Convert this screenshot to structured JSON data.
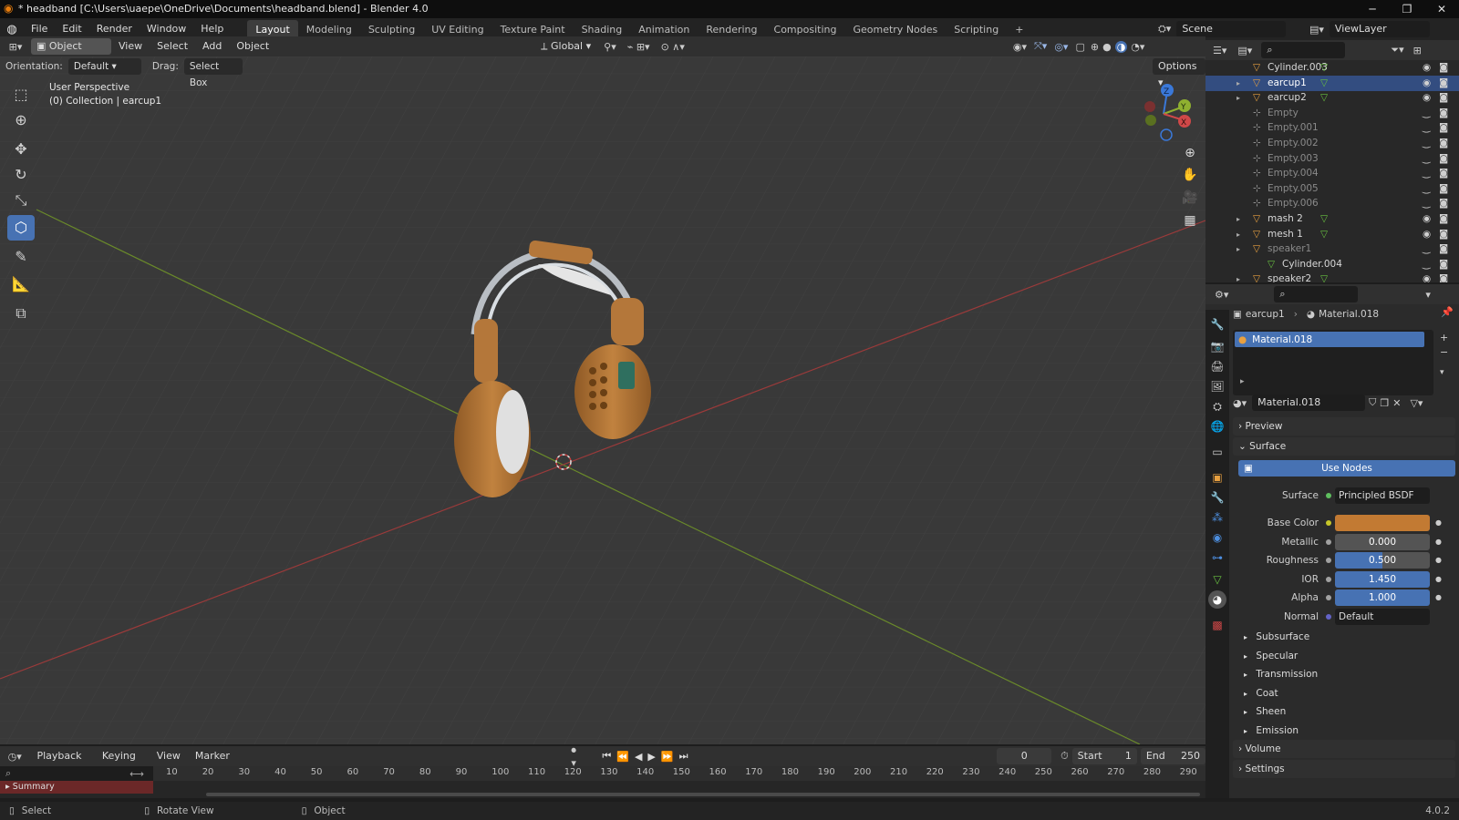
{
  "window": {
    "title": "* headband [C:\\Users\\uaepe\\OneDrive\\Documents\\headband.blend] - Blender 4.0",
    "controls": [
      "─",
      "❐",
      "✕"
    ]
  },
  "menubar": {
    "menus": [
      "File",
      "Edit",
      "Render",
      "Window",
      "Help"
    ],
    "workspaces": [
      "Layout",
      "Modeling",
      "Sculpting",
      "UV Editing",
      "Texture Paint",
      "Shading",
      "Animation",
      "Rendering",
      "Compositing",
      "Geometry Nodes",
      "Scripting"
    ],
    "active_workspace": "Layout",
    "add_tab": "+",
    "scene": "Scene",
    "view_layer": "ViewLayer"
  },
  "viewport_header": {
    "mode": "Object Mode",
    "menus": [
      "View",
      "Select",
      "Add",
      "Object"
    ],
    "transform_orientation": "Global",
    "orientation_label": "Orientation:",
    "orientation_value": "Default",
    "drag_label": "Drag:",
    "drag_value": "Select Box",
    "options": "Options"
  },
  "viewport": {
    "perspective": "User Perspective",
    "collection": "(0) Collection | earcup1",
    "gizmo_axes": [
      "X",
      "Y",
      "Z"
    ],
    "tools": [
      "select-box-tool",
      "cursor-tool",
      "move-tool",
      "rotate-tool",
      "scale-tool",
      "transform-tool",
      "annotate-tool",
      "measure-tool",
      "add-cube-tool"
    ],
    "active_tool": "transform-tool"
  },
  "outliner": {
    "items": [
      {
        "name": "Cylinder.003",
        "type": "mesh",
        "expand": false,
        "selected": false,
        "visible": true,
        "dim": false
      },
      {
        "name": "earcup1",
        "type": "mesh",
        "expand": true,
        "selected": true,
        "visible": true,
        "dim": false
      },
      {
        "name": "earcup2",
        "type": "mesh",
        "expand": true,
        "selected": false,
        "visible": true,
        "dim": false
      },
      {
        "name": "Empty",
        "type": "empty",
        "expand": false,
        "selected": false,
        "visible": false,
        "dim": true
      },
      {
        "name": "Empty.001",
        "type": "empty",
        "expand": false,
        "selected": false,
        "visible": false,
        "dim": true
      },
      {
        "name": "Empty.002",
        "type": "empty",
        "expand": false,
        "selected": false,
        "visible": false,
        "dim": true
      },
      {
        "name": "Empty.003",
        "type": "empty",
        "expand": false,
        "selected": false,
        "visible": false,
        "dim": true
      },
      {
        "name": "Empty.004",
        "type": "empty",
        "expand": false,
        "selected": false,
        "visible": false,
        "dim": true
      },
      {
        "name": "Empty.005",
        "type": "empty",
        "expand": false,
        "selected": false,
        "visible": false,
        "dim": true
      },
      {
        "name": "Empty.006",
        "type": "empty",
        "expand": false,
        "selected": false,
        "visible": false,
        "dim": true
      },
      {
        "name": "mash 2",
        "type": "mesh",
        "expand": true,
        "selected": false,
        "visible": true,
        "dim": false
      },
      {
        "name": "mesh 1",
        "type": "mesh",
        "expand": true,
        "selected": false,
        "visible": true,
        "dim": false
      },
      {
        "name": "speaker1",
        "type": "mesh",
        "expand": true,
        "selected": false,
        "visible": false,
        "dim": true
      },
      {
        "name": "Cylinder.004",
        "type": "meshdata",
        "expand": false,
        "selected": false,
        "visible": false,
        "dim": false,
        "child": true
      },
      {
        "name": "speaker2",
        "type": "mesh",
        "expand": true,
        "selected": false,
        "visible": true,
        "dim": false
      }
    ]
  },
  "properties": {
    "breadcrumb_object": "earcup1",
    "breadcrumb_material": "Material.018",
    "slot_name": "Material.018",
    "material_name": "Material.018",
    "sections": {
      "preview": "Preview",
      "surface": "Surface",
      "use_nodes": "Use Nodes",
      "volume": "Volume",
      "settings": "Settings"
    },
    "surface_label": "Surface",
    "surface_value": "Principled BSDF",
    "fields": [
      {
        "label": "Base Color",
        "value": "",
        "kind": "color",
        "color": "#c27a33",
        "dot": "#c7c729"
      },
      {
        "label": "Metallic",
        "value": "0.000",
        "kind": "number",
        "fill": 0,
        "dot": "#a1a1a1"
      },
      {
        "label": "Roughness",
        "value": "0.500",
        "kind": "number",
        "fill": 0.5,
        "dot": "#a1a1a1"
      },
      {
        "label": "IOR",
        "value": "1.450",
        "kind": "number",
        "fill": 1.0,
        "dot": "#a1a1a1"
      },
      {
        "label": "Alpha",
        "value": "1.000",
        "kind": "number",
        "fill": 1.0,
        "dot": "#a1a1a1"
      },
      {
        "label": "Normal",
        "value": "Default",
        "kind": "text",
        "dot": "#6363c7"
      }
    ],
    "subpanels": [
      "Subsurface",
      "Specular",
      "Transmission",
      "Coat",
      "Sheen",
      "Emission"
    ]
  },
  "timeline": {
    "menus": [
      "Playback",
      "Keying",
      "View",
      "Marker"
    ],
    "current_frame": "0",
    "start_label": "Start",
    "start": "1",
    "end_label": "End",
    "end": "250",
    "ruler": [
      "10",
      "20",
      "30",
      "40",
      "50",
      "60",
      "70",
      "80",
      "90",
      "100",
      "110",
      "120",
      "130",
      "140",
      "150",
      "160",
      "170",
      "180",
      "190",
      "200",
      "210",
      "220",
      "230",
      "240",
      "250",
      "260",
      "270",
      "280",
      "290"
    ],
    "summary": "Summary"
  },
  "statusbar": {
    "select": "Select",
    "rotate": "Rotate View",
    "object": "Object",
    "version": "4.0.2"
  },
  "colors": {
    "accent": "#4772b3",
    "selected_row": "#334d80",
    "headphone": "#b4773a",
    "x_axis": "#9a3a3a",
    "y_axis": "#6a8a2a"
  }
}
